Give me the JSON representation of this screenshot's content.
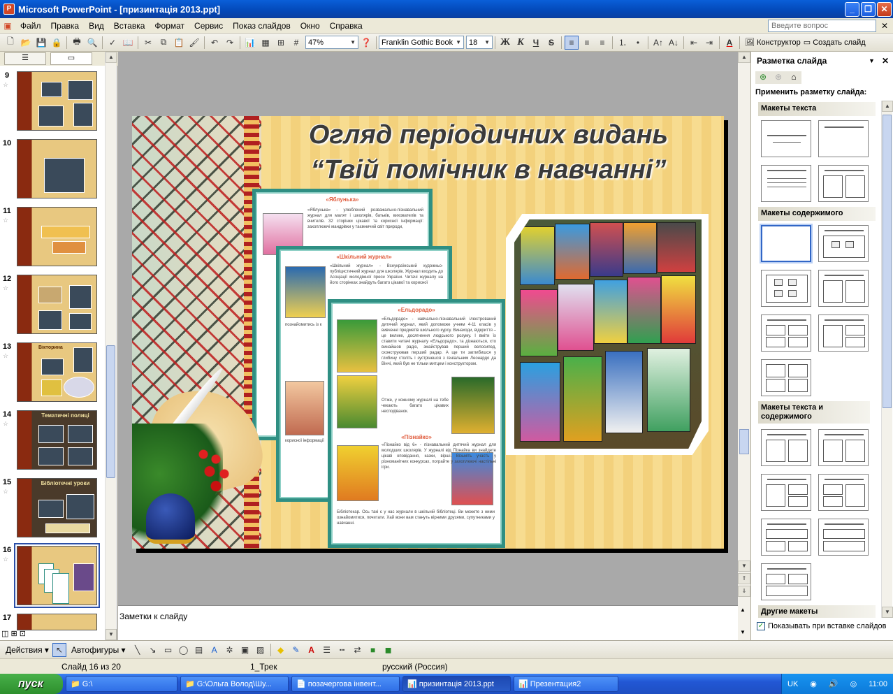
{
  "window": {
    "title": "Microsoft PowerPoint - [призинтація 2013.ppt]",
    "app_icon": "P"
  },
  "menu": {
    "items": [
      "Файл",
      "Правка",
      "Вид",
      "Вставка",
      "Формат",
      "Сервис",
      "Показ слайдов",
      "Окно",
      "Справка"
    ],
    "help_placeholder": "Введите вопрос"
  },
  "toolbar": {
    "zoom": "47%",
    "font": "Franklin Gothic Book",
    "size": "18",
    "bold": "Ж",
    "italic": "К",
    "underline": "Ч",
    "shadow": "S",
    "designer": "Конструктор",
    "new_slide": "Создать слайд"
  },
  "slides_panel": {
    "thumbs": [
      {
        "num": "9",
        "title": ""
      },
      {
        "num": "10",
        "title": ""
      },
      {
        "num": "11",
        "title": ""
      },
      {
        "num": "12",
        "title": ""
      },
      {
        "num": "13",
        "title": "Вікторина"
      },
      {
        "num": "14",
        "title": "Тематичні полиці"
      },
      {
        "num": "15",
        "title": "Бібліотечні уроки"
      },
      {
        "num": "16",
        "title": ""
      },
      {
        "num": "17",
        "title": ""
      }
    ],
    "selected": "16"
  },
  "slide": {
    "title_line1": "Огляд періодичних видань",
    "title_line2": "“Твій помічник в навчанні”",
    "page1": {
      "heading": "«Яблунька»",
      "text": "«Яблунька» - улюблений розважально-пізнавальний журнал для малят і школярів, батьків, вихователів та вчителів. 32 сторінки цікавої та корисної інформації: захоплюючі мандрівки у таємничий світ природи,"
    },
    "page2": {
      "heading": "«Шкільний журнал»",
      "text": "«Шкільний журнал» - Всеукраїнський художньо-публіцистичний журнал для школярів. Журнал входить до Асоціації молодіжної преси України. Читачі журналу на його сторінках знайдуть багато цікавої та корисної",
      "footer1": "познайомитись із к",
      "footer2": "корисної інформації"
    },
    "page3": {
      "heading": "«Ельдорадо»",
      "text": "«Ельдорадо» - навчально-пізнавальний ілюстрований дитячий журнал, який допоможе учням 4-11 класів у вивченні предметів шкільного курсу. Винаходи, відкриття – це велике, досягнення людського розуму. І вміти їх ставити читачі журналу «Ельдорадо», та дізнаються, хто винайшов радіо, змайстрував перший велосипед, сконструював перший радар. А ще ти заглибишся у глибину століть і зустрінешся з геніальним Леонардо да Вінчі, який був не тільки митцем і конструктором.",
      "text2": "Отже, у кожному журналі на тебе чекають багато цікавих несподіванок.",
      "heading2": "«Пізнайко»",
      "text3": "«Пізнайко від 6» - пізнавальний дитячий журнал для молодших школярів. У журналі від Пізнайка ви знайдете цікаві оповідання, казки, вірші. Візьміть участь у різноманітних конкурсах, пограйте у захоплюючі настільні ігри.",
      "text4": "Бібліотекар. Ось такі є у нас журнали в шкільній бібліотеці. Ви можете з ними ознайомитися, почитати. Хай вони вам стануть вірними друзями, супутниками у навчанні."
    }
  },
  "notes": {
    "placeholder": "Заметки к слайду"
  },
  "taskpane": {
    "title": "Разметка слайда",
    "apply_label": "Применить разметку слайда:",
    "sections": [
      "Макеты текста",
      "Макеты содержимого",
      "Макеты текста и содержимого",
      "Другие макеты"
    ],
    "checkbox_label": "Показывать при вставке слайдов",
    "checkbox_checked": true
  },
  "drawbar": {
    "actions": "Действия",
    "autoshapes": "Автофигуры"
  },
  "status": {
    "slide": "Слайд 16 из 20",
    "design": "1_Трек",
    "language": "русский (Россия)"
  },
  "taskbar": {
    "start": "пуск",
    "items": [
      "G:\\",
      "G:\\Ольга Волод\\Шу...",
      "позачергова інвент...",
      "призинтація 2013.ppt",
      "Презентация2"
    ],
    "active": "призинтація 2013.ppt",
    "lang": "UK",
    "clock": "11:00"
  },
  "colors": {
    "accent": "#2f8f83",
    "titlebar": "#0a5fd8",
    "selection": "#3166c6"
  }
}
